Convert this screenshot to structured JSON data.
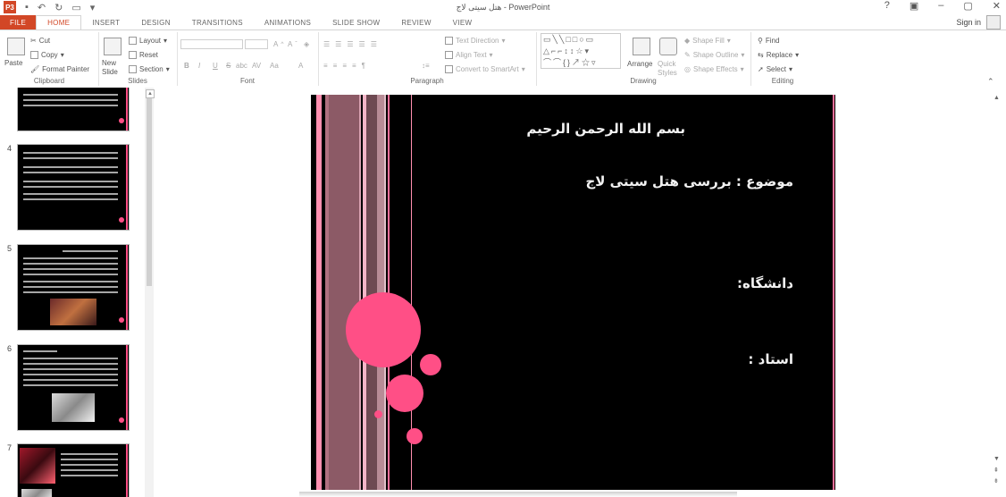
{
  "window": {
    "title": "هتل سیتی لاج - PowerPoint",
    "app_icon": "P3",
    "controls": [
      "?",
      "▣",
      "–",
      "▢",
      "✕"
    ],
    "signin": "Sign in"
  },
  "tabs": [
    "FILE",
    "HOME",
    "INSERT",
    "DESIGN",
    "TRANSITIONS",
    "ANIMATIONS",
    "SLIDE SHOW",
    "REVIEW",
    "VIEW"
  ],
  "ribbon": {
    "clipboard": {
      "label": "Clipboard",
      "paste": "Paste",
      "cut": "Cut",
      "copy": "Copy",
      "format_painter": "Format Painter"
    },
    "slides": {
      "label": "Slides",
      "new_slide": "New Slide",
      "layout": "Layout",
      "reset": "Reset",
      "section": "Section"
    },
    "font": {
      "label": "Font",
      "bold": "B",
      "italic": "I",
      "underline": "U",
      "strike": "S",
      "shadow": "abc",
      "spacing": "AV",
      "case": "Aa",
      "color": "A",
      "grow": "A",
      "shrink": "A"
    },
    "paragraph": {
      "label": "Paragraph",
      "text_direction": "Text Direction",
      "align_text": "Align Text",
      "convert_smartart": "Convert to SmartArt"
    },
    "drawing": {
      "label": "Drawing",
      "arrange": "Arrange",
      "quick_styles": "Quick Styles",
      "shape_fill": "Shape Fill",
      "shape_outline": "Shape Outline",
      "shape_effects": "Shape Effects"
    },
    "editing": {
      "label": "Editing",
      "find": "Find",
      "replace": "Replace",
      "select": "Select"
    }
  },
  "thumbnails": [
    {
      "number": "",
      "variant": "text"
    },
    {
      "number": "4",
      "variant": "text"
    },
    {
      "number": "5",
      "variant": "image"
    },
    {
      "number": "6",
      "variant": "image2"
    },
    {
      "number": "7",
      "variant": "image3"
    }
  ],
  "slide": {
    "line1": "بسم الله الرحمن الرحیم",
    "line2": "موضوع : بررسی هتل سیتی لاج",
    "line3": "دانشگاه:",
    "line4": "استاد :",
    "colors": {
      "accent_pink": "#ff4f86",
      "mauve": "#8c5a66",
      "background": "#000000"
    }
  }
}
